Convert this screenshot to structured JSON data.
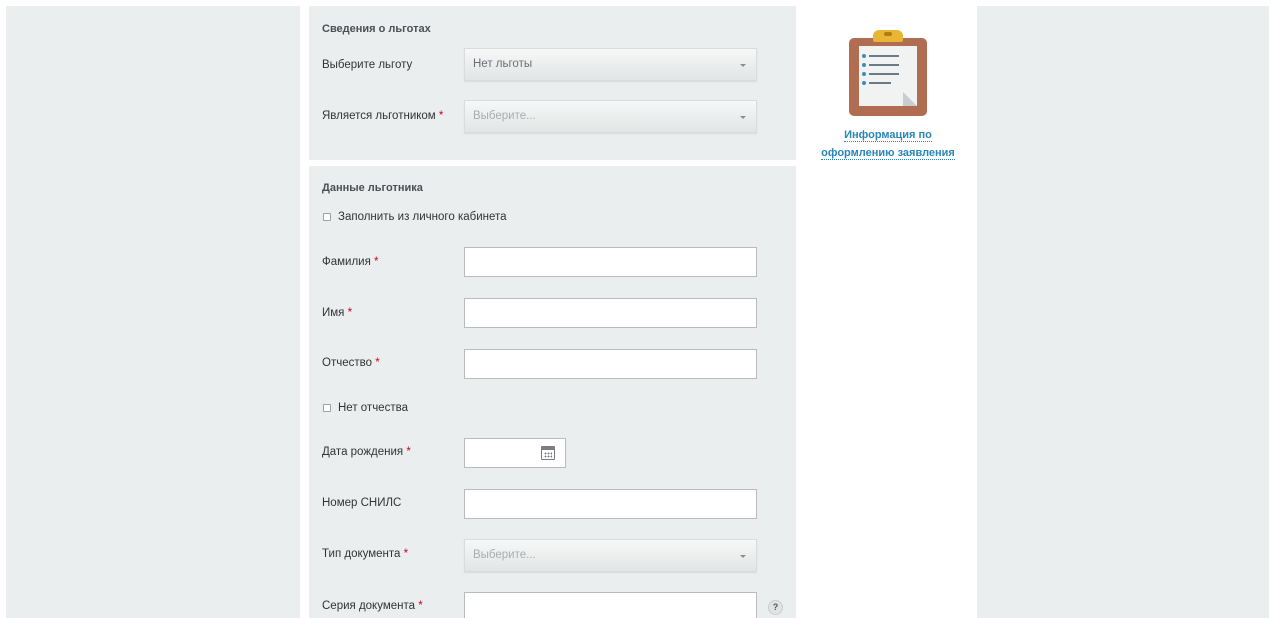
{
  "benefits_section": {
    "title": "Сведения о льготах",
    "select_benefit": {
      "label": "Выберите льготу",
      "value": "Нет льготы"
    },
    "is_beneficiary": {
      "label": "Является льготником",
      "required_mark": "*",
      "placeholder": "Выберите..."
    }
  },
  "beneficiary_section": {
    "title": "Данные льготника",
    "fill_from_cabinet": {
      "label": "Заполнить из личного кабинета",
      "checked": false
    },
    "last_name": {
      "label": "Фамилия",
      "required_mark": "*",
      "value": ""
    },
    "first_name": {
      "label": "Имя",
      "required_mark": "*",
      "value": ""
    },
    "patronymic": {
      "label": "Отчество",
      "required_mark": "*",
      "value": ""
    },
    "no_patronymic": {
      "label": "Нет отчества",
      "checked": false
    },
    "birth_date": {
      "label": "Дата рождения",
      "required_mark": "*",
      "value": "",
      "icon": "calendar-icon"
    },
    "snils": {
      "label": "Номер СНИЛС",
      "value": ""
    },
    "doc_type": {
      "label": "Тип документа",
      "required_mark": "*",
      "placeholder": "Выберите..."
    },
    "doc_series": {
      "label": "Серия документа",
      "required_mark": "*",
      "value": "",
      "help": "?"
    }
  },
  "info": {
    "icon": "clipboard-icon",
    "link_line1": "Информация по",
    "link_line2": "оформлению заявления"
  },
  "colors": {
    "panel_bg": "#ebeeee",
    "required": "#d0021b",
    "link": "#2a86b6"
  }
}
